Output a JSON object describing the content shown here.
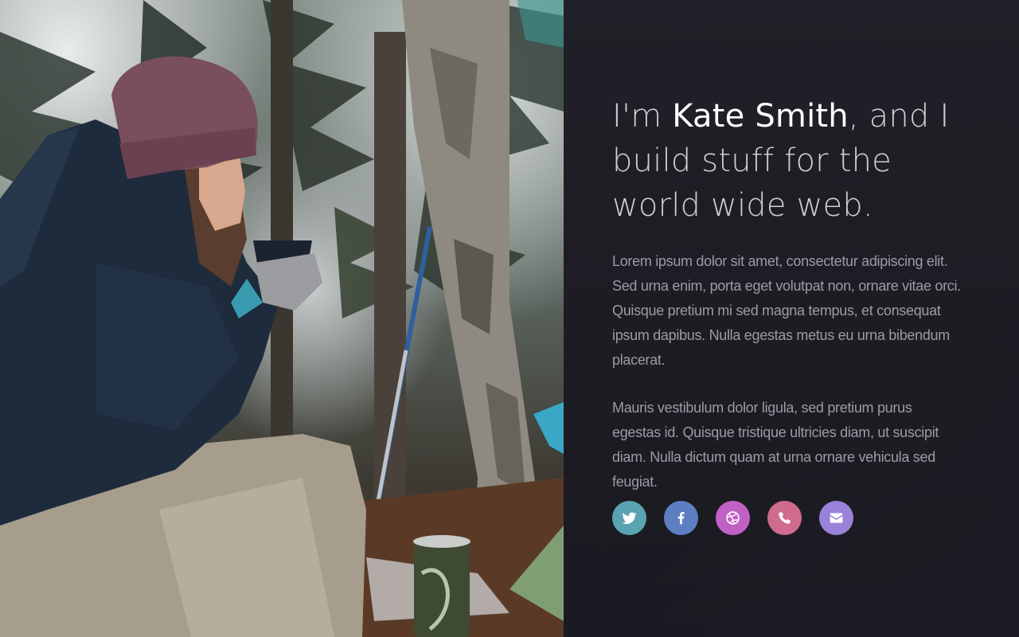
{
  "hero": {
    "intro_prefix": "I'm ",
    "name": "Kate Smith",
    "intro_suffix": ", and I build stuff for the world wide web."
  },
  "bio": {
    "paragraph_1": "Lorem ipsum dolor sit amet, consectetur adipiscing elit. Sed urna enim, porta eget volutpat non, ornare vitae orci. Quisque pretium mi sed magna tempus, et consequat ipsum dapibus. Nulla egestas metus eu urna bibendum placerat.",
    "paragraph_2": "Mauris vestibulum dolor ligula, sed pretium purus egestas id. Quisque tristique ultricies diam, ut suscipit diam. Nulla dictum quam at urna ornare vehicula sed feugiat."
  },
  "social_links": [
    {
      "icon": "twitter-icon",
      "color": "#5aa3b1"
    },
    {
      "icon": "facebook-icon",
      "color": "#5e7ec2"
    },
    {
      "icon": "dribbble-icon",
      "color": "#c261c5"
    },
    {
      "icon": "phone-icon",
      "color": "#cf6b8d"
    },
    {
      "icon": "email-icon",
      "color": "#9a81d9"
    }
  ],
  "colors": {
    "panel_background": "#1e1d24",
    "headline_text": "#cfcdd3",
    "name_highlight": "#ffffff",
    "body_text": "#9d9aa5"
  }
}
